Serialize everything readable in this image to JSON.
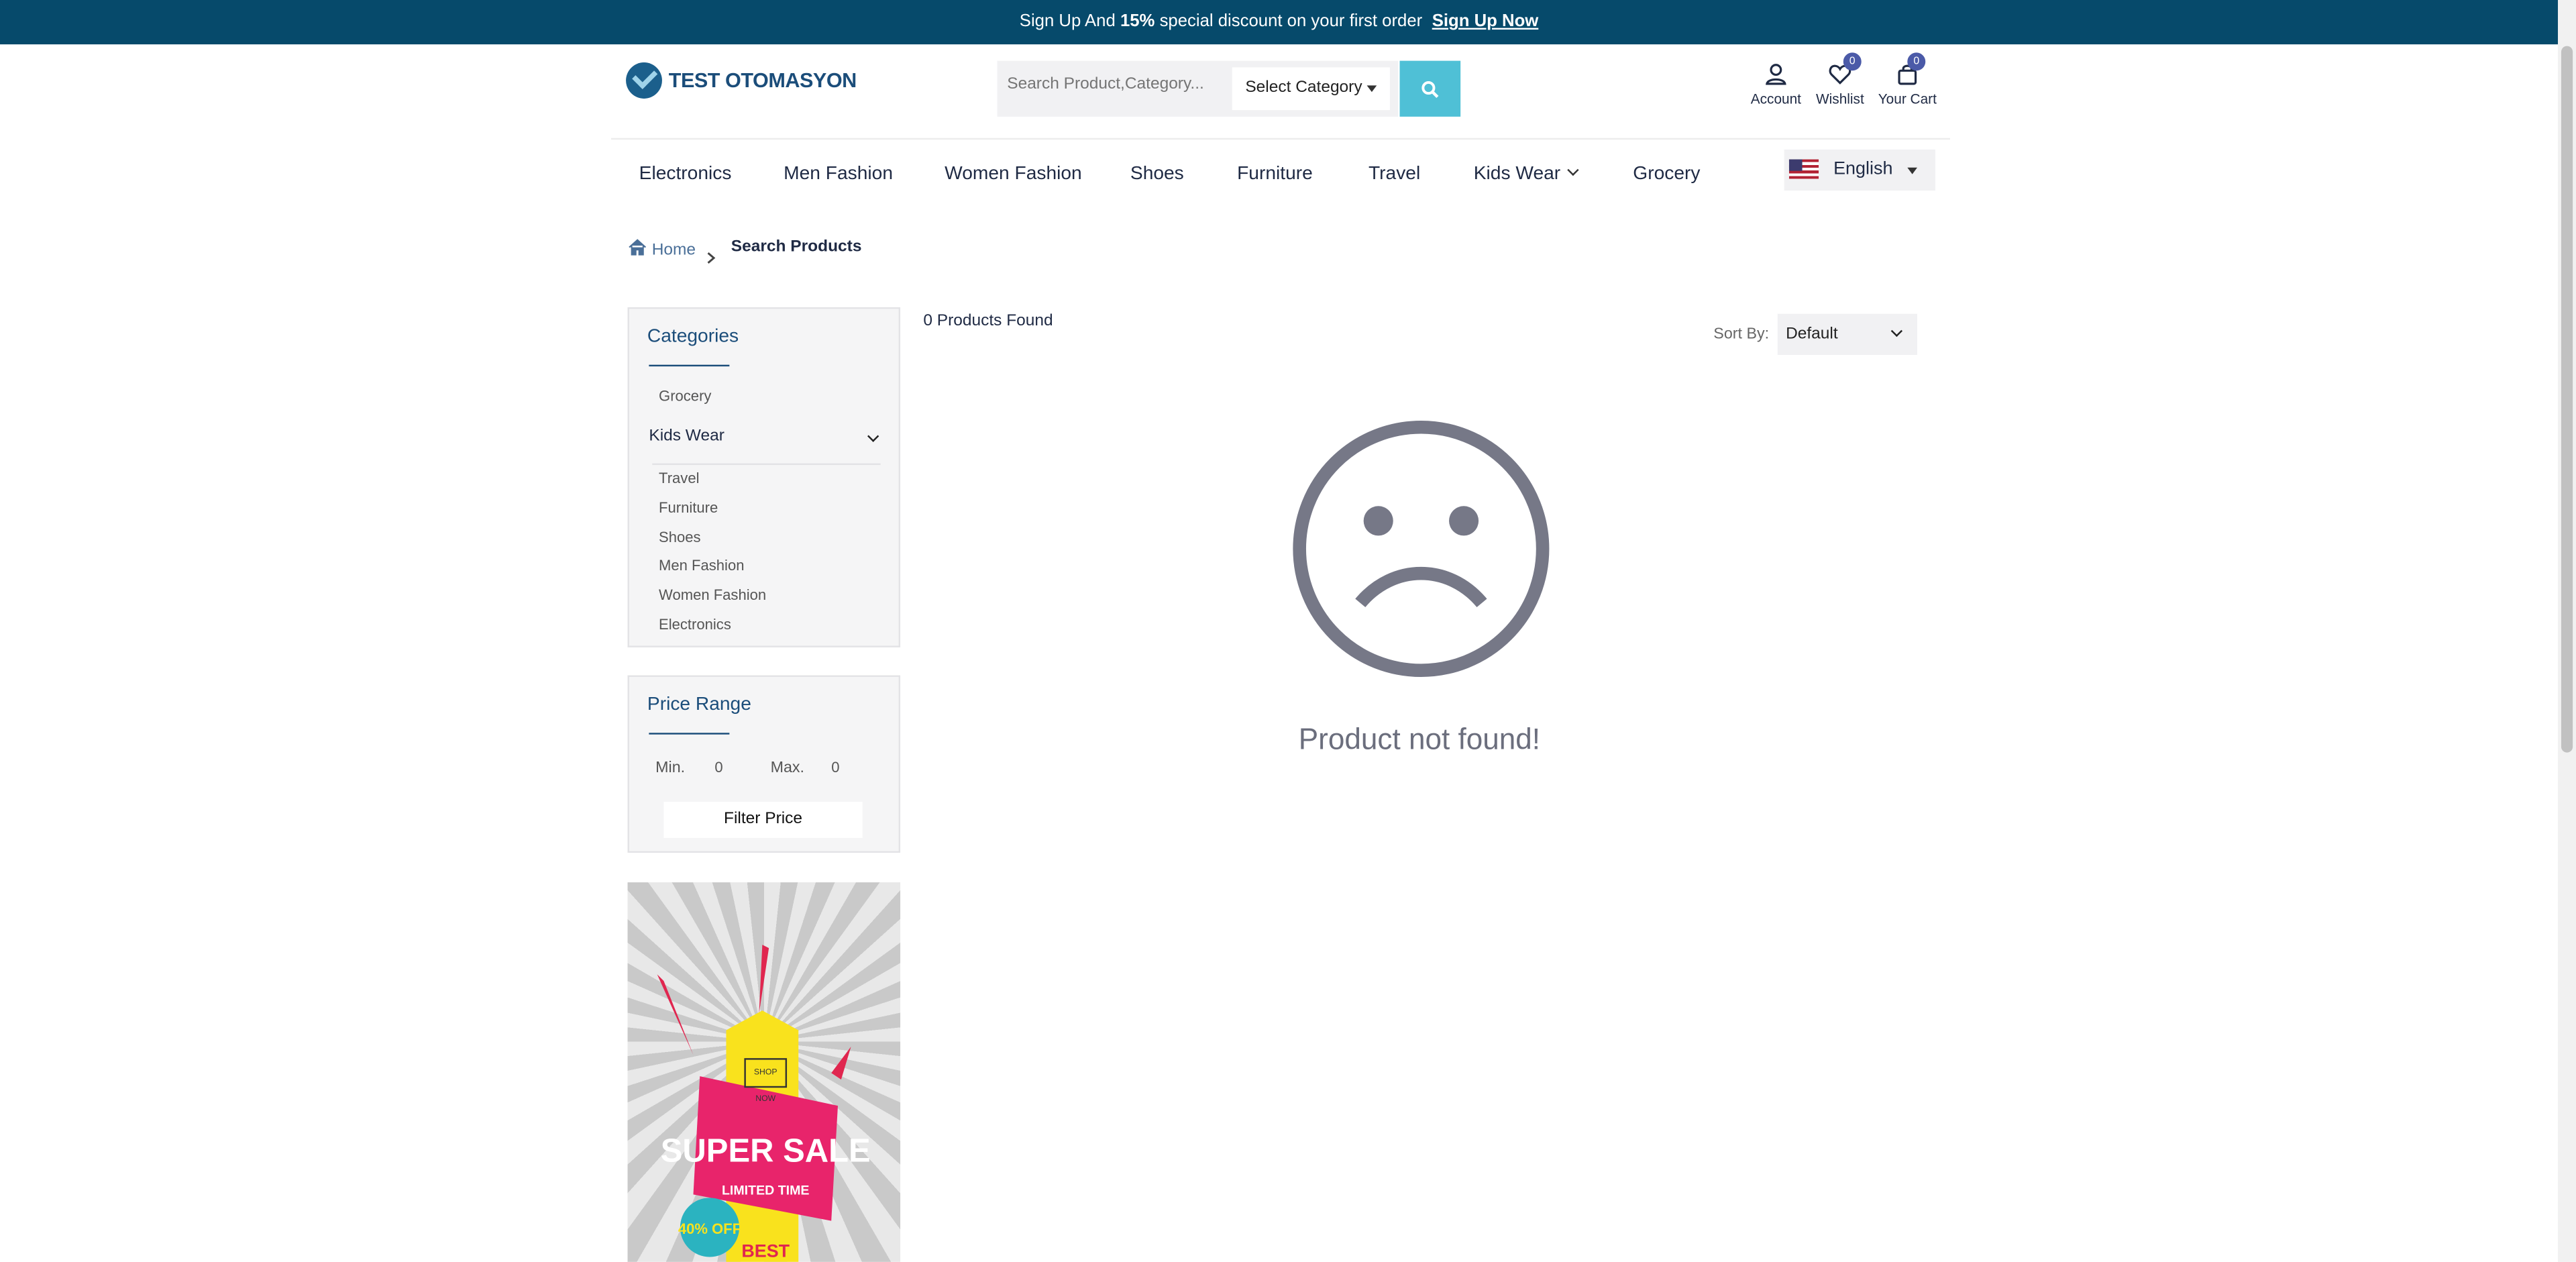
{
  "promo": {
    "prefix": "Sign Up And",
    "highlight": "15%",
    "suffix": "special discount on your first order",
    "link": "Sign Up Now"
  },
  "header": {
    "logo_text": "TEST OTOMASYON",
    "search_placeholder": "Search Product,Category...",
    "category_select": "Select Category",
    "account_label": "Account",
    "wishlist_label": "Wishlist",
    "wishlist_count": "0",
    "cart_label": "Your Cart",
    "cart_count": "0"
  },
  "nav": {
    "items": [
      "Electronics",
      "Men Fashion",
      "Women Fashion",
      "Shoes",
      "Furniture",
      "Travel",
      "Kids Wear",
      "Grocery"
    ],
    "language": "English"
  },
  "breadcrumb": {
    "home": "Home",
    "current": "Search Products"
  },
  "sidebar": {
    "categories_title": "Categories",
    "grocery": "Grocery",
    "kids_wear": "Kids Wear",
    "sub_items": [
      "Travel",
      "Furniture",
      "Shoes",
      "Men Fashion",
      "Women Fashion",
      "Electronics"
    ],
    "price_title": "Price Range",
    "min_label": "Min.",
    "min_value": "0",
    "max_label": "Max.",
    "max_value": "0",
    "filter_button": "Filter Price"
  },
  "banner": {
    "shop_now": "SHOP NOW",
    "super_sale": "SUPER SALE",
    "limited_time": "LIMITED TIME",
    "discount": "40% OFF",
    "best": "BEST"
  },
  "main": {
    "found_text": "0 Products Found",
    "sort_label": "Sort By:",
    "sort_value": "Default",
    "empty_message": "Product not found!"
  },
  "colors": {
    "promo_bg": "#064a6b",
    "accent": "#4fc0d6",
    "badge": "#4b5aa8",
    "sad_face": "#767887"
  }
}
